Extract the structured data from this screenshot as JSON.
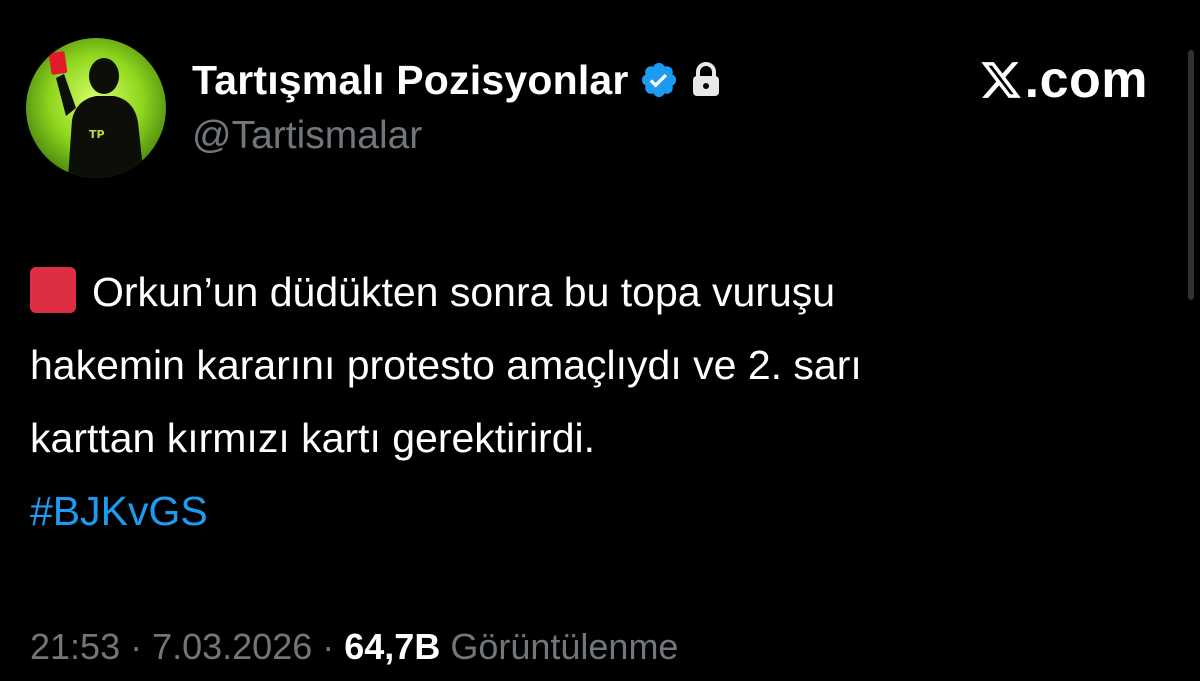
{
  "author": {
    "display_name": "Tartışmalı Pozisyonlar",
    "handle": "@Tartismalar",
    "avatar_text": "TP"
  },
  "brand": {
    "text": ".com",
    "logo_icon": "x-logo-icon"
  },
  "tweet": {
    "lines": [
      "Orkun’un düdükten sonra bu topa vuruşu",
      "hakemin kararını protesto amaçlıydı ve 2. sarı",
      "karttan kırmızı kartı gerektirirdi."
    ],
    "emoji_icon": "red-square-icon",
    "hashtag": "#BJKvGS"
  },
  "meta": {
    "time": "21:53",
    "separator": "·",
    "date": "7.03.2026",
    "views_count": "64,7B",
    "views_label": "Görüntülenme"
  },
  "colors": {
    "background": "#000000",
    "accent": "#1d9bf0",
    "muted": "#71767b",
    "avatar_green": "#8fd61e",
    "red_card": "#dd2e44"
  }
}
